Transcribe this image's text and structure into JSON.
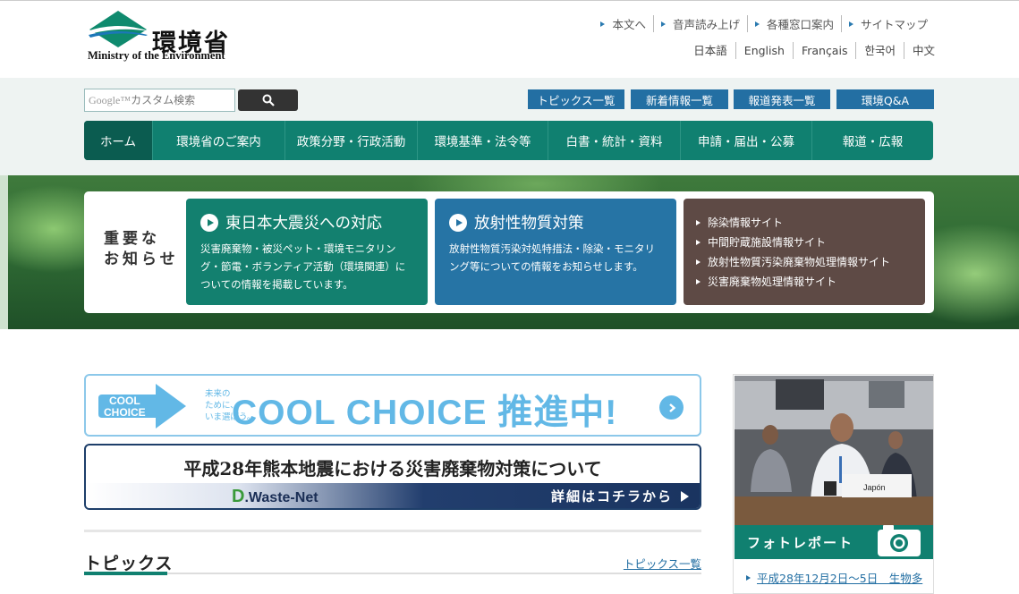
{
  "header": {
    "logo_jp": "環境省",
    "logo_en": "Ministry of the Environment",
    "util_links": [
      "本文へ",
      "音声読み上げ",
      "各種窓口案内",
      "サイトマップ"
    ],
    "lang_links": [
      "日本語",
      "English",
      "Français",
      "한국어",
      "中文"
    ]
  },
  "search": {
    "google_mark": "Google™",
    "placeholder": "カスタム検索",
    "icon": "search-icon"
  },
  "quick_links": [
    "トピックス一覧",
    "新着情報一覧",
    "報道発表一覧",
    "環境Q&A"
  ],
  "nav": [
    "ホーム",
    "環境省のご案内",
    "政策分野・行政活動",
    "環境基準・法令等",
    "白書・統計・資料",
    "申請・届出・公募",
    "報道・広報"
  ],
  "notice": {
    "label_line1": "重要な",
    "label_line2": "お知らせ",
    "card1": {
      "title": "東日本大震災への対応",
      "body": "災害廃棄物・被災ペット・環境モニタリング・節電・ボランティア活動（環境関連）についての情報を掲載しています。"
    },
    "card2": {
      "title": "放射性物質対策",
      "body": "放射性物質汚染対処特措法・除染・モニタリング等についての情報をお知らせします。"
    },
    "card3_links": [
      "除染情報サイト",
      "中間貯蔵施設情報サイト",
      "放射性物質汚染廃棄物処理情報サイト",
      "災害廃棄物処理情報サイト"
    ]
  },
  "banner_cool": {
    "badge_line1": "COOL",
    "badge_line2": "CHOICE",
    "small_text_1": "未来の",
    "small_text_2": "ために、",
    "small_text_3": "いま選ぼう。",
    "main": "COOL CHOICE 推進中!"
  },
  "banner_waste": {
    "title": "平成28年熊本地震における災害廃棄物対策について",
    "logo_d": "D",
    "logo_rest": ".Waste-Net",
    "cta": "詳細はコチラから"
  },
  "topics": {
    "title": "トピックス",
    "all_link": "トピックス一覧"
  },
  "photo_report": {
    "title": "フォトレポート",
    "placard": "Japón",
    "link": "平成28年12月2日～5日　生物多"
  },
  "colors": {
    "brand_green": "#108070",
    "nav_active": "#0b5c50",
    "quick_blue": "#236fa3",
    "card_green": "#13806f",
    "card_blue": "#2674a5",
    "card_brown": "#5e4a45",
    "cool_blue": "#62b8e6"
  }
}
